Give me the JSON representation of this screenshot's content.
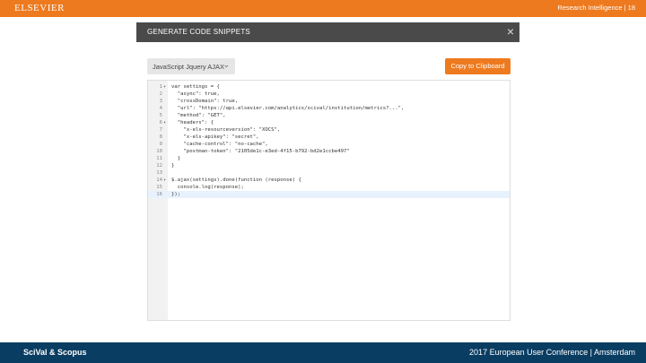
{
  "header": {
    "brand": "ELSEVIER",
    "right_text": "Research Intelligence  |  18"
  },
  "dialog": {
    "title": "GENERATE CODE SNIPPETS",
    "close_symbol": "×",
    "language_select": "JavaScript Jquery AJAX",
    "copy_button": "Copy to Clipboard"
  },
  "code": {
    "lines": [
      {
        "n": "1",
        "fold": "▾",
        "text": "var settings = {"
      },
      {
        "n": "2",
        "fold": "",
        "text": "  \"async\": true,"
      },
      {
        "n": "3",
        "fold": "",
        "text": "  \"crossDomain\": true,"
      },
      {
        "n": "4",
        "fold": "",
        "text": "  \"url\": \"https://api.elsevier.com/analytics/scival/institution/metrics?...\","
      },
      {
        "n": "5",
        "fold": "",
        "text": "  \"method\": \"GET\","
      },
      {
        "n": "6",
        "fold": "▾",
        "text": "  \"headers\": {"
      },
      {
        "n": "7",
        "fold": "",
        "text": "    \"x-els-resourceversion\": \"XOCS\","
      },
      {
        "n": "8",
        "fold": "",
        "text": "    \"x-els-apikey\": \"secret\","
      },
      {
        "n": "9",
        "fold": "",
        "text": "    \"cache-control\": \"no-cache\","
      },
      {
        "n": "10",
        "fold": "",
        "text": "    \"postman-token\": \"2105de1c-e3ed-4f15-b792-bd2e1ccbe497\""
      },
      {
        "n": "11",
        "fold": "",
        "text": "  }"
      },
      {
        "n": "12",
        "fold": "",
        "text": "}"
      },
      {
        "n": "13",
        "fold": "",
        "text": ""
      },
      {
        "n": "14",
        "fold": "▾",
        "text": "$.ajax(settings).done(function (response) {"
      },
      {
        "n": "15",
        "fold": "",
        "text": "  console.log(response);"
      },
      {
        "n": "16",
        "fold": "",
        "text": "});"
      }
    ]
  },
  "footer": {
    "left": "SciVal & Scopus",
    "right": "2017 European User Conference | Amsterdam"
  }
}
